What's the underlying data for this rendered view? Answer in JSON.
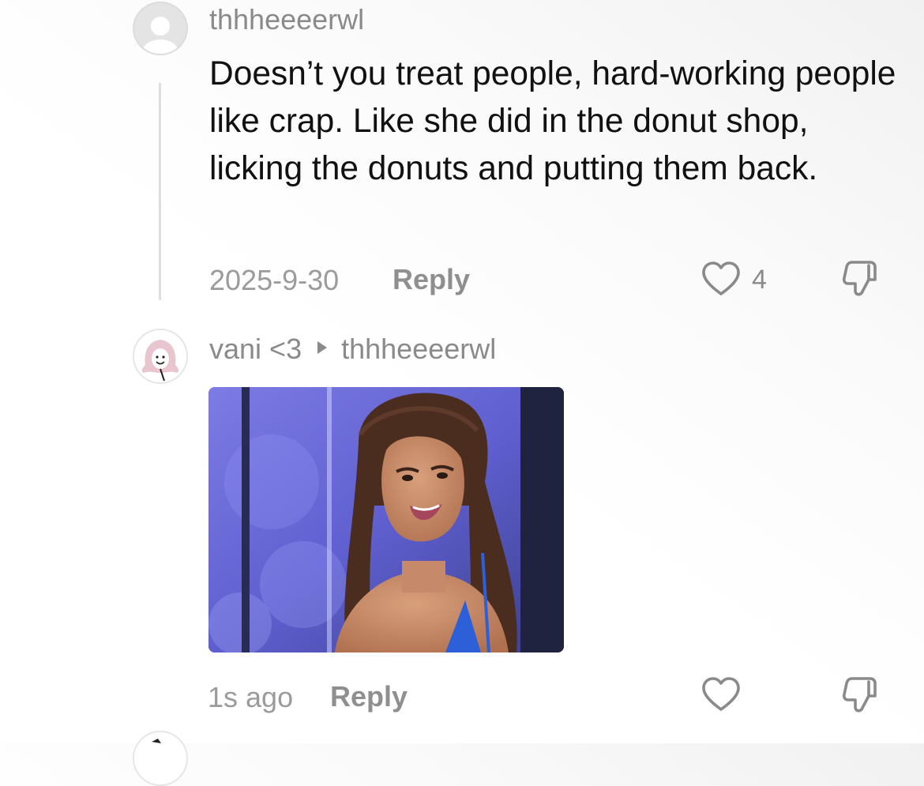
{
  "comment_1": {
    "username": "thhheeeerwl",
    "text": "Doesn’t you treat people, hard-working people like crap. Like she did in the donut shop, licking the donuts and putting them back.",
    "date": "2025-9-30",
    "reply_label": "Reply",
    "like_count": "4",
    "like_icon": "heart-outline-icon",
    "dislike_icon": "thumbs-down-icon"
  },
  "comment_2": {
    "username": "vani <3",
    "reply_to": "thhheeeerwl",
    "reply_arrow_icon": "play-arrow-icon",
    "attachment": "photo of a smiling woman with a long high ponytail in a blue top",
    "time": "1s ago",
    "reply_label": "Reply",
    "like_icon": "heart-outline-icon",
    "dislike_icon": "thumbs-down-icon"
  },
  "colors": {
    "text_primary": "#111111",
    "text_secondary": "#8a8a8a",
    "thread_line": "#dedede",
    "photo_background": "#5e63d6",
    "top_blue": "#2f62d6"
  }
}
